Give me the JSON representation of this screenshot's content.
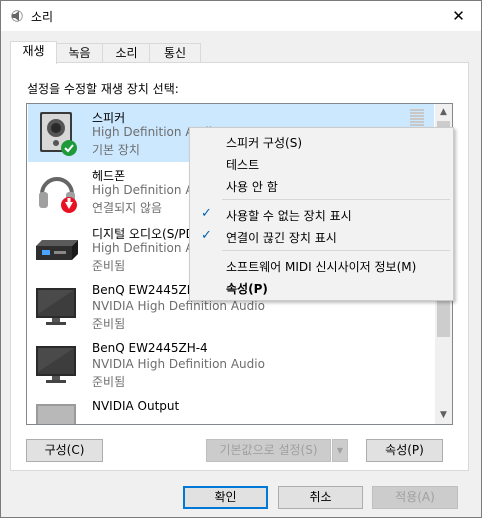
{
  "window": {
    "title": "소리",
    "close_glyph": "✕",
    "icon": "speaker-icon"
  },
  "tabs": [
    {
      "label": "재생",
      "active": true
    },
    {
      "label": "녹음",
      "active": false
    },
    {
      "label": "소리",
      "active": false
    },
    {
      "label": "통신",
      "active": false
    }
  ],
  "panel": {
    "instruction": "설정을 수정할 재생 장치 선택:"
  },
  "devices": [
    {
      "name": "스피커",
      "desc": "High Definition Audio",
      "status": "기본 장치",
      "icon": "speaker-icon",
      "badge": "default-check-icon",
      "selected": true
    },
    {
      "name": "헤드폰",
      "desc": "High Definition Audio",
      "status": "연결되지 않음",
      "icon": "headphones-icon",
      "badge": "disconnected-arrow-icon",
      "selected": false
    },
    {
      "name": "디지털 오디오(S/PDIF)",
      "desc": "High Definition Audio",
      "status": "준비됨",
      "icon": "digital-audio-icon",
      "selected": false
    },
    {
      "name": "BenQ EW2445ZH-4",
      "desc": "NVIDIA High Definition Audio",
      "status": "준비됨",
      "icon": "monitor-icon",
      "selected": false
    },
    {
      "name": "BenQ EW2445ZH-4",
      "desc": "NVIDIA High Definition Audio",
      "status": "준비됨",
      "icon": "monitor-icon",
      "selected": false
    },
    {
      "name": "NVIDIA Output",
      "desc": "",
      "status": "",
      "icon": "monitor-icon",
      "selected": false
    }
  ],
  "panel_buttons": {
    "configure": "구성(C)",
    "set_default": "기본값으로 설정(S)",
    "properties": "속성(P)"
  },
  "dialog_buttons": {
    "ok": "확인",
    "cancel": "취소",
    "apply": "적용(A)"
  },
  "context_menu": {
    "items": [
      {
        "label": "스피커 구성(S)",
        "checked": false,
        "bold": false
      },
      {
        "label": "테스트",
        "checked": false,
        "bold": false
      },
      {
        "label": "사용 안 함",
        "checked": false,
        "bold": false
      },
      {
        "label": "사용할 수 없는 장치 표시",
        "checked": true,
        "bold": false
      },
      {
        "label": "연결이 끊긴 장치 표시",
        "checked": true,
        "bold": false
      },
      {
        "label": "소프트웨어 MIDI 신시사이저 정보(M)",
        "checked": false,
        "bold": false
      },
      {
        "label": "속성(P)",
        "checked": false,
        "bold": true
      }
    ],
    "check_glyph": "✓"
  },
  "colors": {
    "selection": "#cce8ff",
    "accent": "#0078d7",
    "check_green": "#1f9a3a",
    "disconnected_red": "#e81123"
  }
}
